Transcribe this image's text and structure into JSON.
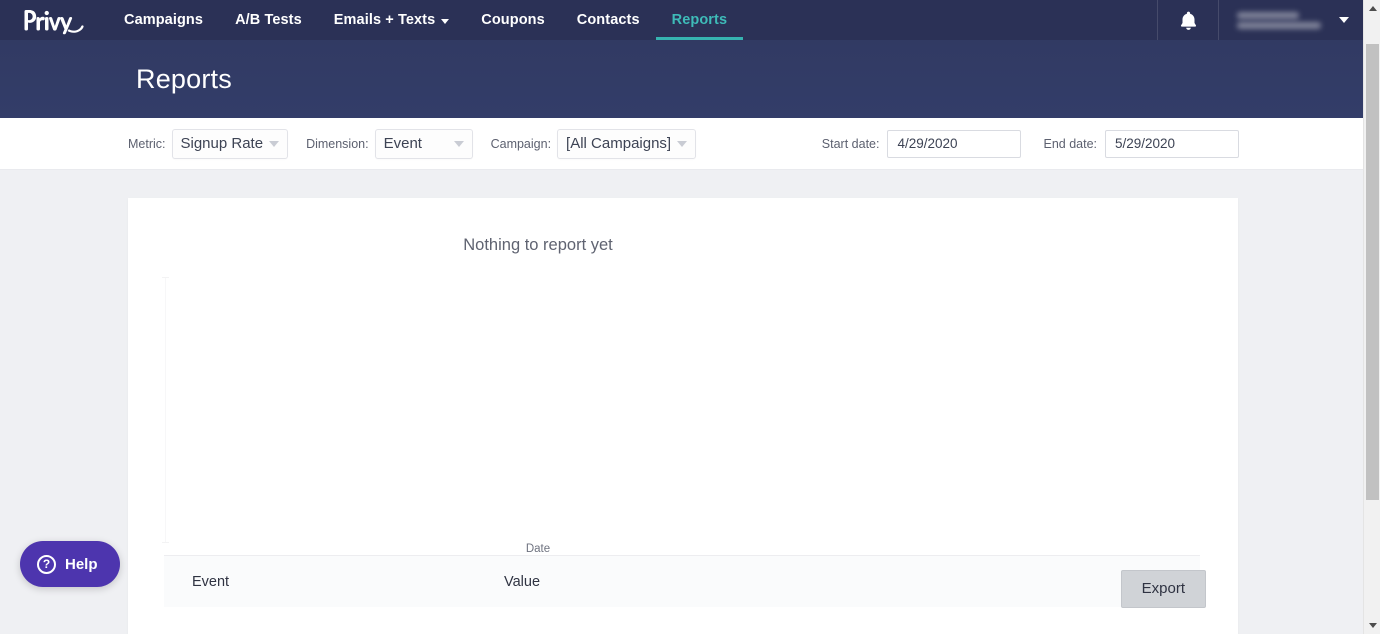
{
  "nav": {
    "logo_alt": "Privy",
    "items": [
      {
        "label": "Campaigns",
        "active": false,
        "has_caret": false
      },
      {
        "label": "A/B Tests",
        "active": false,
        "has_caret": false
      },
      {
        "label": "Emails + Texts",
        "active": false,
        "has_caret": true
      },
      {
        "label": "Coupons",
        "active": false,
        "has_caret": false
      },
      {
        "label": "Contacts",
        "active": false,
        "has_caret": false
      },
      {
        "label": "Reports",
        "active": true,
        "has_caret": false
      }
    ],
    "notifications_icon": "bell-icon",
    "account_caret_icon": "chevron-down-icon",
    "active_color": "#3ebbb8",
    "bar_color": "#2b3156"
  },
  "header": {
    "title": "Reports",
    "band_color": "#323c67"
  },
  "filters": {
    "metric": {
      "label": "Metric:",
      "value": "Signup Rate"
    },
    "dimension": {
      "label": "Dimension:",
      "value": "Event"
    },
    "campaign": {
      "label": "Campaign:",
      "value": "[All Campaigns]"
    },
    "start_date": {
      "label": "Start date:",
      "value": "4/29/2020",
      "placeholder": "mm/dd/yyyy"
    },
    "end_date": {
      "label": "End date:",
      "value": "5/29/2020",
      "placeholder": "mm/dd/yyyy"
    }
  },
  "chart_data": {
    "type": "line",
    "title": "Nothing to report yet",
    "empty_message": "Nothing to report yet",
    "xlabel": "Date",
    "ylabel": "",
    "categories": [],
    "values": [],
    "series": [],
    "grid": false,
    "legend": "none",
    "is_empty": true
  },
  "table": {
    "columns": [
      "Event",
      "Value"
    ],
    "rows": [],
    "export_label": "Export"
  },
  "help": {
    "label": "Help",
    "icon": "question-circle-icon",
    "color": "#4d35ae"
  },
  "scrollbar": {
    "up_icon": "caret-up-icon",
    "down_icon": "caret-down-icon"
  }
}
